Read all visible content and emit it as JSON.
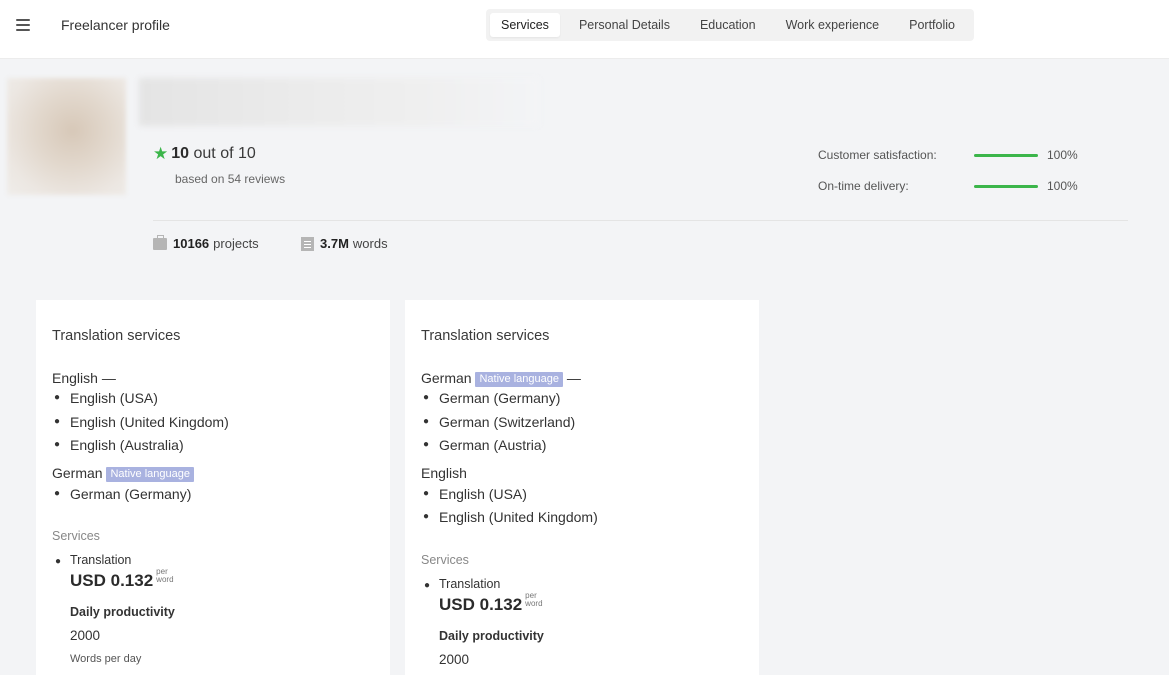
{
  "header": {
    "title": "Freelancer profile",
    "tabs": [
      {
        "label": "Services",
        "active": true
      },
      {
        "label": "Personal Details",
        "active": false
      },
      {
        "label": "Education",
        "active": false
      },
      {
        "label": "Work experience",
        "active": false
      },
      {
        "label": "Portfolio",
        "active": false
      }
    ]
  },
  "profile": {
    "rating": {
      "score": "10",
      "out_of": "out of 10",
      "reviews": "based on 54 reviews",
      "icon": "star-icon"
    },
    "metrics": [
      {
        "label": "Customer satisfaction:",
        "value": "100%",
        "fraction": 1.0
      },
      {
        "label": "On-time delivery:",
        "value": "100%",
        "fraction": 1.0
      }
    ],
    "stats": {
      "projects_value": "10166",
      "projects_label": "projects",
      "words_value": "3.7M",
      "words_label": "words"
    }
  },
  "badge_label": "Native language",
  "cards": [
    {
      "title": "Translation services",
      "languages": [
        {
          "name": "English",
          "native": false,
          "suffix": "—",
          "variants": [
            "English (USA)",
            "English (United Kingdom)",
            "English (Australia)"
          ]
        },
        {
          "name": "German",
          "native": true,
          "suffix": "",
          "variants": [
            "German (Germany)"
          ]
        }
      ],
      "services_heading": "Services",
      "service": {
        "name": "Translation",
        "price": "USD 0.132",
        "per": "per",
        "unit": "word"
      },
      "productivity_label": "Daily productivity",
      "productivity_value": "2000",
      "productivity_unit": "Words per day"
    },
    {
      "title": "Translation services",
      "languages": [
        {
          "name": "German",
          "native": true,
          "suffix": "—",
          "variants": [
            "German (Germany)",
            "German (Switzerland)",
            "German (Austria)"
          ]
        },
        {
          "name": "English",
          "native": false,
          "suffix": "",
          "variants": [
            "English (USA)",
            "English (United Kingdom)"
          ]
        }
      ],
      "services_heading": "Services",
      "service": {
        "name": "Translation",
        "price": "USD 0.132",
        "per": "per",
        "unit": "word"
      },
      "productivity_label": "Daily productivity",
      "productivity_value": "2000"
    }
  ],
  "colors": {
    "accent_green": "#3bb54a",
    "badge": "#a9b2e0"
  }
}
